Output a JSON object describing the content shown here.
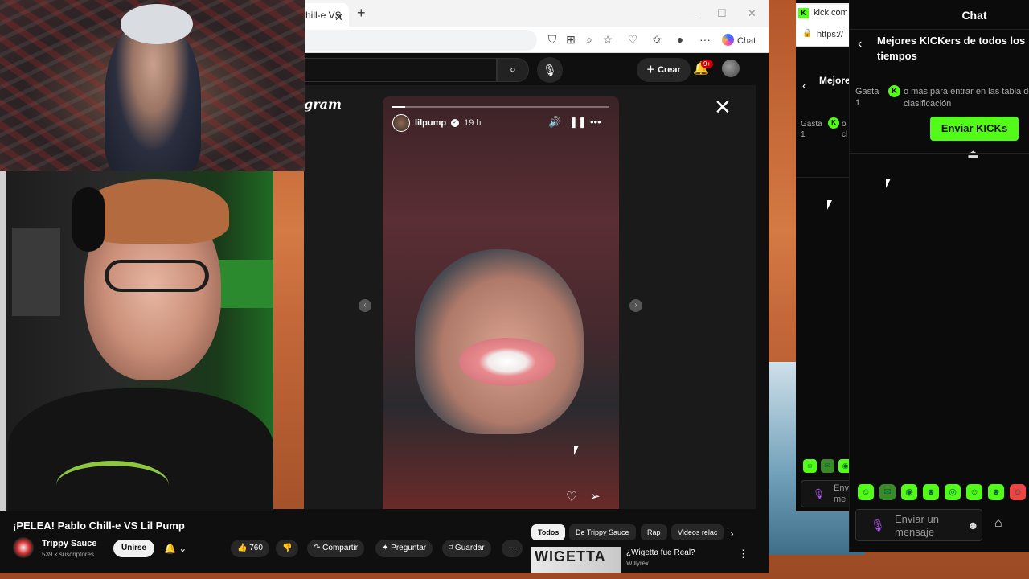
{
  "browser": {
    "tab_title": "hill-e VS",
    "tab_close": "✕",
    "new_tab": "+",
    "window_controls": [
      "—",
      "☐",
      "✕"
    ],
    "copilot_label": "Chat",
    "more_label": "···"
  },
  "youtube": {
    "header": {
      "search_icon": "search-icon",
      "create_label": "Crear",
      "notif_badge": "9+"
    },
    "video": {
      "title": "¡PELEA! Pablo Chill-e VS Lil Pump",
      "channel": "Trippy Sauce",
      "subscribers": "539 k suscriptores",
      "join_label": "Unirse",
      "likes": "760",
      "share_label": "Compartir",
      "ask_label": "Preguntar",
      "save_label": "Guardar",
      "more_label": "···"
    },
    "chips": [
      "Todos",
      "De Trippy Sauce",
      "Rap",
      "Videos relac"
    ],
    "recommendation": {
      "thumb_text": "WIGETTA",
      "title": "¿Wigetta fue Real?",
      "channel": "Willyrex"
    }
  },
  "instagram": {
    "logo_fragment": "gram",
    "story_user": "lilpump",
    "story_time": "19 h",
    "story_progress": 0.06
  },
  "kick": {
    "tab_title": "kick.com",
    "url": "https://",
    "left_title": "Mejores tiempo",
    "left_spend": "Gasta\n1",
    "left_desc": "o\ncl",
    "left_input_ph": "Envi\nme",
    "chat": {
      "title": "Chat",
      "leaderboard_title": "Mejores KICKers de todos los tiempos",
      "spend_prefix": "Gasta",
      "spend_amount": "1",
      "spend_desc": "o más para entrar en las tabla de clasificación",
      "send_kicks_label": "Enviar KICKs",
      "input_placeholder": "Enviar un mensaje"
    }
  },
  "colors": {
    "kick_green": "#53fc18",
    "yt_bg": "#0f0f0f",
    "yt_red": "#cc0000",
    "mic_purple": "#b44df5"
  }
}
